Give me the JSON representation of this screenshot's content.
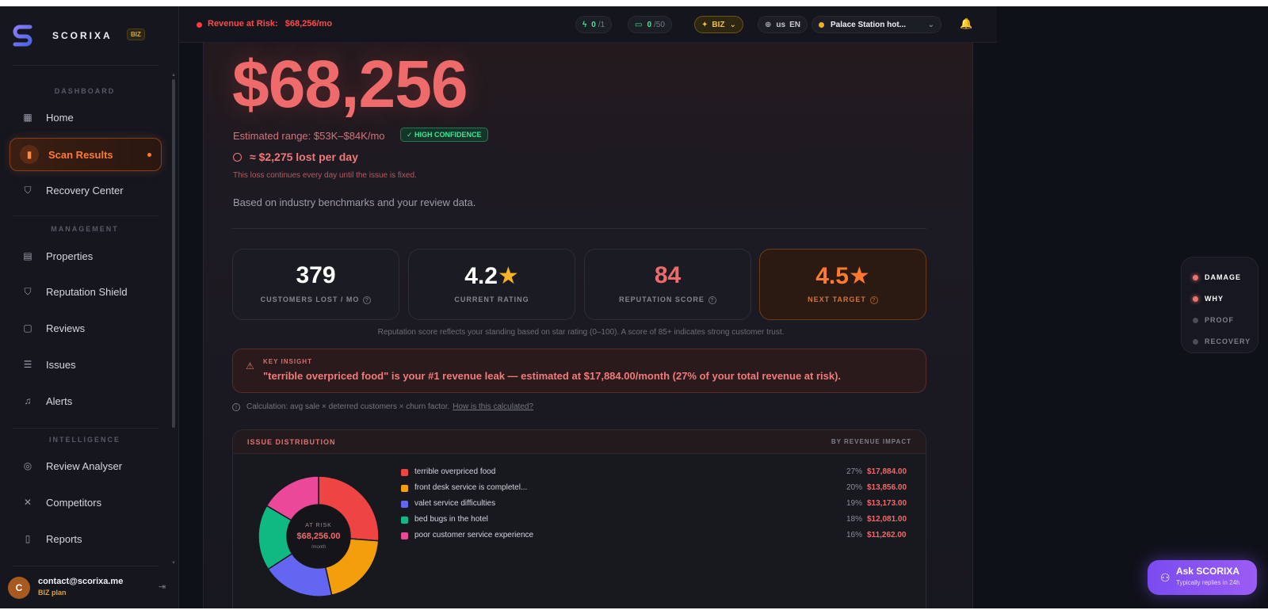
{
  "brand": {
    "name": "SCORIXA",
    "badge": "BIZ"
  },
  "sidebar": {
    "sections": {
      "dashboard": "DASHBOARD",
      "management": "MANAGEMENT",
      "intelligence": "INTELLIGENCE"
    },
    "items": [
      {
        "label": "Home",
        "icon": "grid-icon"
      },
      {
        "label": "Scan Results",
        "icon": "bar-chart-icon",
        "active": true
      },
      {
        "label": "Recovery Center",
        "icon": "shield-check-icon"
      },
      {
        "label": "Properties",
        "icon": "building-icon"
      },
      {
        "label": "Reputation Shield",
        "icon": "shield-icon"
      },
      {
        "label": "Reviews",
        "icon": "message-icon"
      },
      {
        "label": "Issues",
        "icon": "list-check-icon"
      },
      {
        "label": "Alerts",
        "icon": "bell-icon"
      },
      {
        "label": "Review Analyser",
        "icon": "target-icon"
      },
      {
        "label": "Competitors",
        "icon": "swords-icon"
      },
      {
        "label": "Reports",
        "icon": "file-icon"
      }
    ],
    "user": {
      "initial": "C",
      "email": "contact@scorixa.me",
      "plan": "BIZ plan"
    }
  },
  "topbar": {
    "risk_label": "Revenue at Risk:",
    "risk_value": "$68,256/mo",
    "scans": {
      "used": "0",
      "total": "/1"
    },
    "messages": {
      "used": "0",
      "total": "/50"
    },
    "plan": "BIZ",
    "lang_country": "us",
    "lang": "EN",
    "hotel": "Palace Station hot..."
  },
  "main": {
    "amount": "$68,256",
    "range": "Estimated range: $53K–$84K/mo",
    "confidence": "✓ HIGH CONFIDENCE",
    "per_day": "≈ $2,275 lost per day",
    "loss_note": "This loss continues every day until the issue is fixed.",
    "benchmark": "Based on industry benchmarks and your review data.",
    "stats": [
      {
        "value": "379",
        "label": "CUSTOMERS LOST / MO"
      },
      {
        "value": "4.2",
        "star": "★",
        "label": "CURRENT RATING"
      },
      {
        "value": "84",
        "label": "REPUTATION SCORE"
      },
      {
        "value": "4.5",
        "star": "★",
        "label": "NEXT TARGET"
      }
    ],
    "rep_note": "Reputation score reflects your standing based on star rating (0–100). A score of 85+ indicates strong customer trust.",
    "insight": {
      "title": "KEY INSIGHT",
      "message": "\"terrible overpriced food\" is your #1 revenue leak — estimated at $17,884.00/month (27% of your total revenue at risk)."
    },
    "calc": {
      "text": "Calculation: avg sale × deterred customers × churn factor.",
      "link": "How is this calculated?"
    }
  },
  "chart_data": {
    "type": "pie",
    "title": "ISSUE DISTRIBUTION",
    "subtitle": "BY REVENUE IMPACT",
    "center_label": "AT RISK",
    "center_value": "$68,256.00",
    "center_unit": "/month",
    "categories": [
      "terrible overpriced food",
      "front desk service is completel...",
      "valet service difficulties",
      "bed bugs in the hotel",
      "poor customer service experience"
    ],
    "values": [
      17884.0,
      13856.0,
      13173.0,
      12081.0,
      11262.0
    ],
    "percent_labels": [
      "27%",
      "20%",
      "19%",
      "18%",
      "16%"
    ],
    "amount_labels": [
      "$17,884.00",
      "$13,856.00",
      "$13,173.00",
      "$12,081.00",
      "$11,262.00"
    ],
    "colors": [
      "#ef4444",
      "#f59e0b",
      "#6366f1",
      "#10b981",
      "#ec4899"
    ]
  },
  "sidepanel": [
    {
      "label": "DAMAGE",
      "state": "active"
    },
    {
      "label": "WHY",
      "state": "active"
    },
    {
      "label": "PROOF",
      "state": "inactive"
    },
    {
      "label": "RECOVERY",
      "state": "inactive"
    }
  ],
  "ask": {
    "title": "Ask SCORIXA",
    "subtitle": "Typically replies in 24h"
  }
}
